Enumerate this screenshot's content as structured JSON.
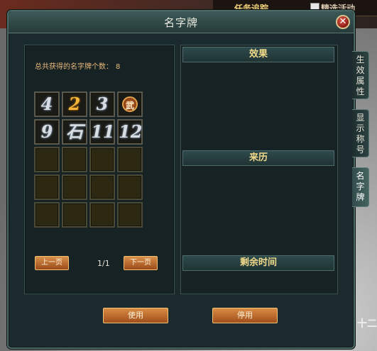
{
  "hud": {
    "task_label": "任务追踪",
    "trace_label": "精选活动"
  },
  "window": {
    "title": "名字牌",
    "close_glyph": "✕"
  },
  "collection": {
    "count_label": "总共获得的名字牌个数：",
    "count_value": "8",
    "slots": [
      {
        "glyph": "4",
        "style": "silver"
      },
      {
        "glyph": "2",
        "style": "gold"
      },
      {
        "glyph": "3",
        "style": "silver"
      },
      {
        "glyph": "武",
        "style": "seal"
      },
      {
        "glyph": "9",
        "style": "silver"
      },
      {
        "glyph": "石",
        "style": "silver"
      },
      {
        "glyph": "11",
        "style": "silver"
      },
      {
        "glyph": "12",
        "style": "silver"
      },
      {
        "glyph": "",
        "style": "empty"
      },
      {
        "glyph": "",
        "style": "empty"
      },
      {
        "glyph": "",
        "style": "empty"
      },
      {
        "glyph": "",
        "style": "empty"
      },
      {
        "glyph": "",
        "style": "empty"
      },
      {
        "glyph": "",
        "style": "empty"
      },
      {
        "glyph": "",
        "style": "empty"
      },
      {
        "glyph": "",
        "style": "empty"
      },
      {
        "glyph": "",
        "style": "empty"
      },
      {
        "glyph": "",
        "style": "empty"
      },
      {
        "glyph": "",
        "style": "empty"
      },
      {
        "glyph": "",
        "style": "empty"
      }
    ]
  },
  "pagination": {
    "prev_label": "上一页",
    "next_label": "下一页",
    "page_indicator": "1/1"
  },
  "details": {
    "effect_header": "效果",
    "origin_header": "来历",
    "time_header": "剩余时间"
  },
  "side_tabs": {
    "tab1": "生效属性",
    "tab2": "显示称号",
    "tab3": "名字牌"
  },
  "actions": {
    "use_label": "使用",
    "disable_label": "停用"
  },
  "corner": "十二"
}
